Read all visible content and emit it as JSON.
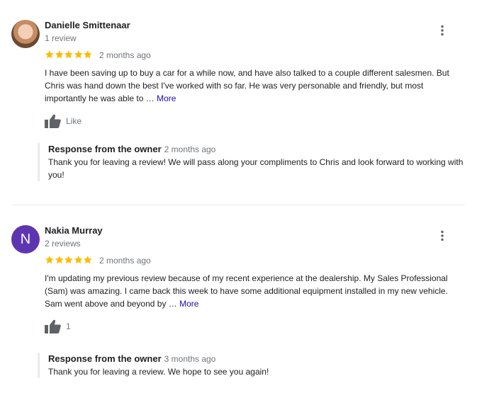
{
  "reviews": [
    {
      "reviewer_name": "Danielle Smittenaar",
      "review_count": "1 review",
      "rating": 5,
      "date": "2 months ago",
      "text": "I have been saving up to buy a car for a while now, and have also talked to a couple different salesmen. But Chris was hand down the best I've worked with so far. He was very personable and friendly, but most importantly he was able to …",
      "more_label": "More",
      "like_label": "Like",
      "avatar_icon": "profile-photo",
      "response": {
        "title": "Response from the owner",
        "date": "2 months ago",
        "text": "Thank you for leaving a review! We will pass along your compliments to Chris and look forward to working with you!"
      }
    },
    {
      "reviewer_name": "Nakia Murray",
      "review_count": "2 reviews",
      "avatar_letter": "N",
      "avatar_color": "#5e35b1",
      "rating": 5,
      "date": "2 months ago",
      "text": "I'm updating my previous review because of my recent experience at the dealership. My Sales Professional (Sam) was amazing.  I came back this week to have some additional equipment installed in my new vehicle.  Sam went above and beyond by …",
      "more_label": "More",
      "like_label": "1",
      "response": {
        "title": "Response from the owner",
        "date": "3 months ago",
        "text": "Thank you for leaving a review. We hope to see you again!"
      }
    }
  ],
  "colors": {
    "star": "#fbbc04",
    "link": "#1a0dab",
    "muted": "#70757a",
    "icon": "#5f6368"
  },
  "icons": {
    "star": "star-icon",
    "menu": "more-vert-icon",
    "like": "thumb-up-icon"
  }
}
